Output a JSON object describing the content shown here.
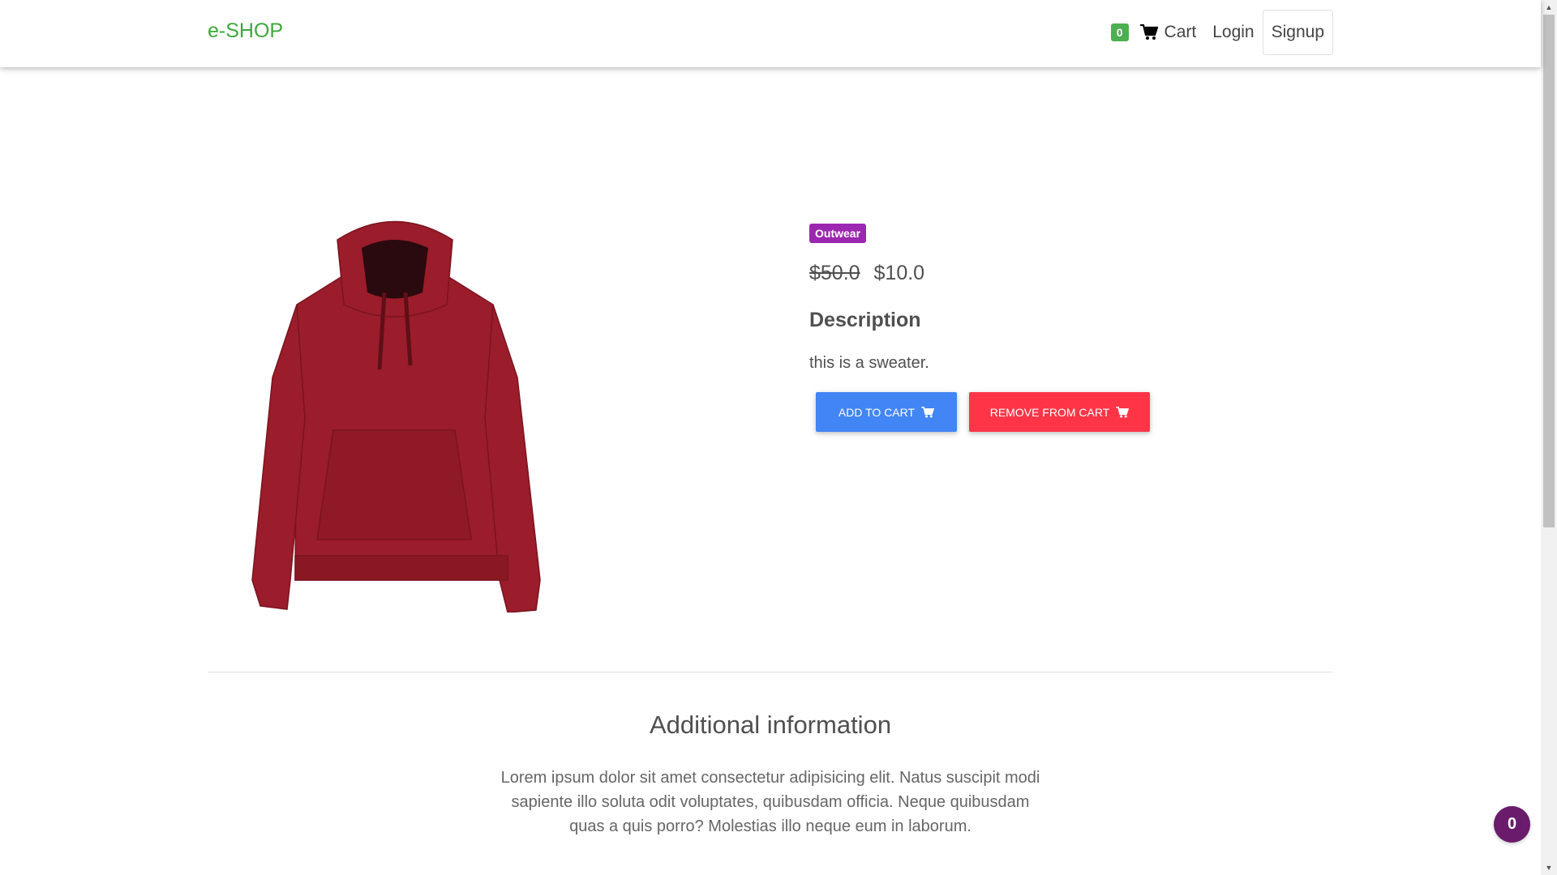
{
  "navbar": {
    "brand": "e-SHOP",
    "cart_count": "0",
    "cart_label": "Cart",
    "login_label": "Login",
    "signup_label": "Signup"
  },
  "product": {
    "category_badge": "Outwear",
    "old_price": "$50.0",
    "price": "$10.0",
    "description_title": "Description",
    "description": "this is a sweater.",
    "add_to_cart_label": "ADD TO CART",
    "remove_from_cart_label": "REMOVE FROM CART",
    "image_color": "#9b1c2a"
  },
  "additional": {
    "title": "Additional information",
    "text": "Lorem ipsum dolor sit amet consectetur adipisicing elit. Natus suscipit modi sapiente illo soluta odit voluptates, quibusdam officia. Neque quibusdam quas a quis porro? Molestias illo neque eum in laborum."
  },
  "floating_badge": "0",
  "colors": {
    "brand": "#3ea83b",
    "cart_count_bg": "#4caf50",
    "badge_bg": "#9c27b0",
    "add_button": "#4285f4",
    "remove_button": "#ff3547",
    "fab": "#6a1b6b"
  }
}
